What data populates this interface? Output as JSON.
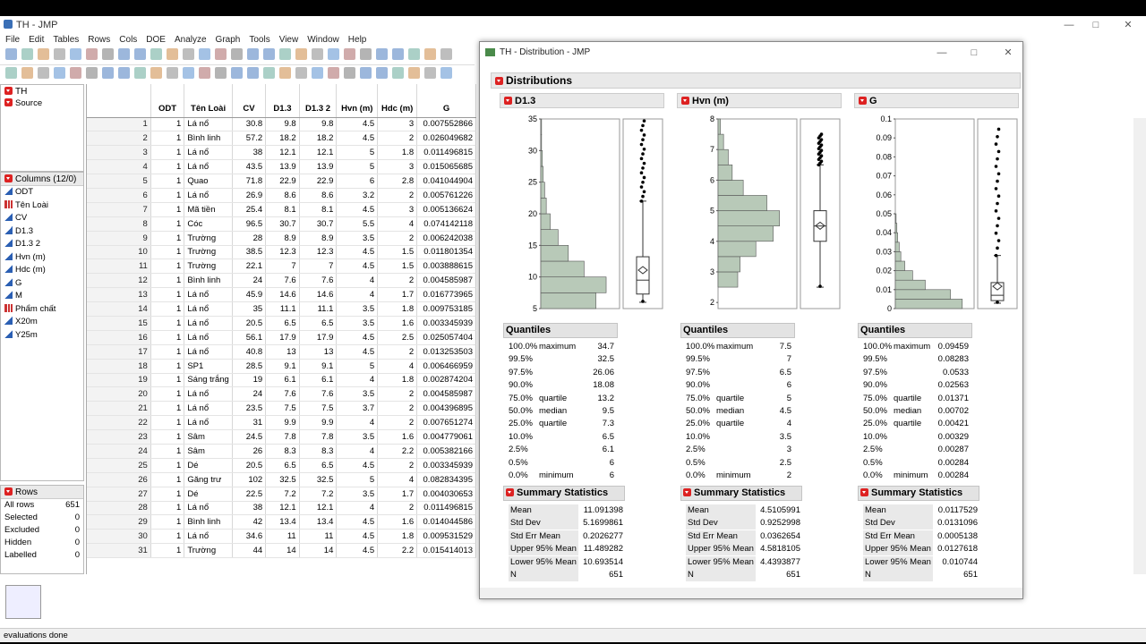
{
  "main": {
    "title": "TH - JMP",
    "menu": [
      "File",
      "Edit",
      "Tables",
      "Rows",
      "Cols",
      "DOE",
      "Analyze",
      "Graph",
      "Tools",
      "View",
      "Window",
      "Help"
    ],
    "status": "evaluations done"
  },
  "left": {
    "table_name": "TH",
    "source": "Source",
    "columns_header": "Columns (12/0)",
    "columns": [
      {
        "name": "ODT",
        "type": "continuous"
      },
      {
        "name": "Tên Loài",
        "type": "nominal"
      },
      {
        "name": "CV",
        "type": "continuous"
      },
      {
        "name": "D1.3",
        "type": "continuous"
      },
      {
        "name": "D1.3 2",
        "type": "continuous"
      },
      {
        "name": "Hvn (m)",
        "type": "continuous"
      },
      {
        "name": "Hdc (m)",
        "type": "continuous"
      },
      {
        "name": "G",
        "type": "continuous"
      },
      {
        "name": "M",
        "type": "continuous"
      },
      {
        "name": "Phẩm chất",
        "type": "nominal"
      },
      {
        "name": "X20m",
        "type": "continuous"
      },
      {
        "name": "Y25m",
        "type": "continuous"
      }
    ],
    "rows_header": "Rows",
    "rows_stats": [
      {
        "label": "All rows",
        "value": "651"
      },
      {
        "label": "Selected",
        "value": "0"
      },
      {
        "label": "Excluded",
        "value": "0"
      },
      {
        "label": "Hidden",
        "value": "0"
      },
      {
        "label": "Labelled",
        "value": "0"
      }
    ]
  },
  "table": {
    "headers": [
      "ODT",
      "Tên Loài",
      "CV",
      "D1.3",
      "D1.3 2",
      "Hvn (m)",
      "Hdc (m)",
      "G"
    ],
    "rows": [
      [
        "1",
        "1",
        "Lá nổ",
        "30.8",
        "9.8",
        "9.8",
        "4.5",
        "3",
        "0.007552866"
      ],
      [
        "2",
        "1",
        "Bình linh",
        "57.2",
        "18.2",
        "18.2",
        "4.5",
        "2",
        "0.026049682"
      ],
      [
        "3",
        "1",
        "Lá nổ",
        "38",
        "12.1",
        "12.1",
        "5",
        "1.8",
        "0.011496815"
      ],
      [
        "4",
        "1",
        "Lá nổ",
        "43.5",
        "13.9",
        "13.9",
        "5",
        "3",
        "0.015065685"
      ],
      [
        "5",
        "1",
        "Quao",
        "71.8",
        "22.9",
        "22.9",
        "6",
        "2.8",
        "0.041044904"
      ],
      [
        "6",
        "1",
        "Lá nổ",
        "26.9",
        "8.6",
        "8.6",
        "3.2",
        "2",
        "0.005761226"
      ],
      [
        "7",
        "1",
        "Mã tiền",
        "25.4",
        "8.1",
        "8.1",
        "4.5",
        "3",
        "0.005136624"
      ],
      [
        "8",
        "1",
        "Cóc",
        "96.5",
        "30.7",
        "30.7",
        "5.5",
        "4",
        "0.074142118"
      ],
      [
        "9",
        "1",
        "Trường",
        "28",
        "8.9",
        "8.9",
        "3.5",
        "2",
        "0.006242038"
      ],
      [
        "10",
        "1",
        "Trường",
        "38.5",
        "12.3",
        "12.3",
        "4.5",
        "1.5",
        "0.011801354"
      ],
      [
        "11",
        "1",
        "Trường",
        "22.1",
        "7",
        "7",
        "4.5",
        "1.5",
        "0.003888615"
      ],
      [
        "12",
        "1",
        "Bình linh",
        "24",
        "7.6",
        "7.6",
        "4",
        "2",
        "0.004585987"
      ],
      [
        "13",
        "1",
        "Lá nổ",
        "45.9",
        "14.6",
        "14.6",
        "4",
        "1.7",
        "0.016773965"
      ],
      [
        "14",
        "1",
        "Lá nổ",
        "35",
        "11.1",
        "11.1",
        "3.5",
        "1.8",
        "0.009753185"
      ],
      [
        "15",
        "1",
        "Lá nổ",
        "20.5",
        "6.5",
        "6.5",
        "3.5",
        "1.6",
        "0.003345939"
      ],
      [
        "16",
        "1",
        "Lá nổ",
        "56.1",
        "17.9",
        "17.9",
        "4.5",
        "2.5",
        "0.025057404"
      ],
      [
        "17",
        "1",
        "Lá nổ",
        "40.8",
        "13",
        "13",
        "4.5",
        "2",
        "0.013253503"
      ],
      [
        "18",
        "1",
        "SP1",
        "28.5",
        "9.1",
        "9.1",
        "5",
        "4",
        "0.006466959"
      ],
      [
        "19",
        "1",
        "Sáng trắng",
        "19",
        "6.1",
        "6.1",
        "4",
        "1.8",
        "0.002874204"
      ],
      [
        "20",
        "1",
        "Lá nổ",
        "24",
        "7.6",
        "7.6",
        "3.5",
        "2",
        "0.004585987"
      ],
      [
        "21",
        "1",
        "Lá nổ",
        "23.5",
        "7.5",
        "7.5",
        "3.7",
        "2",
        "0.004396895"
      ],
      [
        "22",
        "1",
        "Lá nổ",
        "31",
        "9.9",
        "9.9",
        "4",
        "2",
        "0.007651274"
      ],
      [
        "23",
        "1",
        "Sâm",
        "24.5",
        "7.8",
        "7.8",
        "3.5",
        "1.6",
        "0.004779061"
      ],
      [
        "24",
        "1",
        "Sâm",
        "26",
        "8.3",
        "8.3",
        "4",
        "2.2",
        "0.005382166"
      ],
      [
        "25",
        "1",
        "Dé",
        "20.5",
        "6.5",
        "6.5",
        "4.5",
        "2",
        "0.003345939"
      ],
      [
        "26",
        "1",
        "Găng trư",
        "102",
        "32.5",
        "32.5",
        "5",
        "4",
        "0.082834395"
      ],
      [
        "27",
        "1",
        "Dé",
        "22.5",
        "7.2",
        "7.2",
        "3.5",
        "1.7",
        "0.004030653"
      ],
      [
        "28",
        "1",
        "Lá nổ",
        "38",
        "12.1",
        "12.1",
        "4",
        "2",
        "0.011496815"
      ],
      [
        "29",
        "1",
        "Bình linh",
        "42",
        "13.4",
        "13.4",
        "4.5",
        "1.6",
        "0.014044586"
      ],
      [
        "30",
        "1",
        "Lá nổ",
        "34.6",
        "11",
        "11",
        "4.5",
        "1.8",
        "0.009531529"
      ],
      [
        "31",
        "1",
        "Trường",
        "44",
        "14",
        "14",
        "4.5",
        "2.2",
        "0.015414013"
      ]
    ]
  },
  "dist": {
    "title": "TH - Distribution - JMP",
    "heading": "Distributions",
    "quantiles_label": "Quantiles",
    "summary_label": "Summary Statistics",
    "vars": [
      {
        "name": "D1.3",
        "quantiles": [
          [
            "100.0%",
            "maximum",
            "34.7"
          ],
          [
            "99.5%",
            "",
            "32.5"
          ],
          [
            "97.5%",
            "",
            "26.06"
          ],
          [
            "90.0%",
            "",
            "18.08"
          ],
          [
            "75.0%",
            "quartile",
            "13.2"
          ],
          [
            "50.0%",
            "median",
            "9.5"
          ],
          [
            "25.0%",
            "quartile",
            "7.3"
          ],
          [
            "10.0%",
            "",
            "6.5"
          ],
          [
            "2.5%",
            "",
            "6.1"
          ],
          [
            "0.5%",
            "",
            "6"
          ],
          [
            "0.0%",
            "minimum",
            "6"
          ]
        ],
        "summary": [
          [
            "Mean",
            "11.091398"
          ],
          [
            "Std Dev",
            "5.1699861"
          ],
          [
            "Std Err Mean",
            "0.2026277"
          ],
          [
            "Upper 95% Mean",
            "11.489282"
          ],
          [
            "Lower 95% Mean",
            "10.693514"
          ],
          [
            "N",
            "651"
          ]
        ]
      },
      {
        "name": "Hvn (m)",
        "quantiles": [
          [
            "100.0%",
            "maximum",
            "7.5"
          ],
          [
            "99.5%",
            "",
            "7"
          ],
          [
            "97.5%",
            "",
            "6.5"
          ],
          [
            "90.0%",
            "",
            "6"
          ],
          [
            "75.0%",
            "quartile",
            "5"
          ],
          [
            "50.0%",
            "median",
            "4.5"
          ],
          [
            "25.0%",
            "quartile",
            "4"
          ],
          [
            "10.0%",
            "",
            "3.5"
          ],
          [
            "2.5%",
            "",
            "3"
          ],
          [
            "0.5%",
            "",
            "2.5"
          ],
          [
            "0.0%",
            "minimum",
            "2"
          ]
        ],
        "summary": [
          [
            "Mean",
            "4.5105991"
          ],
          [
            "Std Dev",
            "0.9252998"
          ],
          [
            "Std Err Mean",
            "0.0362654"
          ],
          [
            "Upper 95% Mean",
            "4.5818105"
          ],
          [
            "Lower 95% Mean",
            "4.4393877"
          ],
          [
            "N",
            "651"
          ]
        ]
      },
      {
        "name": "G",
        "quantiles": [
          [
            "100.0%",
            "maximum",
            "0.09459"
          ],
          [
            "99.5%",
            "",
            "0.08283"
          ],
          [
            "97.5%",
            "",
            "0.0533"
          ],
          [
            "90.0%",
            "",
            "0.02563"
          ],
          [
            "75.0%",
            "quartile",
            "0.01371"
          ],
          [
            "50.0%",
            "median",
            "0.00702"
          ],
          [
            "25.0%",
            "quartile",
            "0.00421"
          ],
          [
            "10.0%",
            "",
            "0.00329"
          ],
          [
            "2.5%",
            "",
            "0.00287"
          ],
          [
            "0.5%",
            "",
            "0.00284"
          ],
          [
            "0.0%",
            "minimum",
            "0.00284"
          ]
        ],
        "summary": [
          [
            "Mean",
            "0.0117529"
          ],
          [
            "Std Dev",
            "0.0131096"
          ],
          [
            "Std Err Mean",
            "0.0005138"
          ],
          [
            "Upper 95% Mean",
            "0.0127618"
          ],
          [
            "Lower 95% Mean",
            "0.010744"
          ],
          [
            "N",
            "651"
          ]
        ]
      }
    ]
  },
  "chart_data": [
    {
      "type": "bar",
      "title": "D1.3",
      "orientation": "horizontal histogram",
      "yticks": [
        5,
        10,
        15,
        20,
        25,
        30,
        35
      ],
      "ylim": [
        5,
        35
      ],
      "bin_width": 2.5,
      "bins": [
        [
          5,
          7.5,
          0.7
        ],
        [
          7.5,
          10,
          0.83
        ],
        [
          10,
          12.5,
          0.55
        ],
        [
          12.5,
          15,
          0.35
        ],
        [
          15,
          17.5,
          0.22
        ],
        [
          17.5,
          20,
          0.12
        ],
        [
          20,
          22.5,
          0.07
        ],
        [
          22.5,
          25,
          0.05
        ],
        [
          25,
          27.5,
          0.03
        ],
        [
          27.5,
          30,
          0.02
        ],
        [
          30,
          32.5,
          0.01
        ],
        [
          32.5,
          35,
          0.01
        ]
      ],
      "box": {
        "min": 6,
        "q1": 7.3,
        "median": 9.5,
        "q3": 13.2,
        "whisker_high": 22,
        "mean": 11.09,
        "max": 34.7
      },
      "color": "#b8c9b8"
    },
    {
      "type": "bar",
      "title": "Hvn (m)",
      "orientation": "horizontal histogram",
      "yticks": [
        2,
        3,
        4,
        5,
        6,
        7,
        8
      ],
      "ylim": [
        1.8,
        8
      ],
      "bin_width": 0.5,
      "bins": [
        [
          2.5,
          3,
          0.25
        ],
        [
          3,
          3.5,
          0.28
        ],
        [
          3.5,
          4,
          0.48
        ],
        [
          4,
          4.5,
          0.7
        ],
        [
          4.5,
          5,
          0.78
        ],
        [
          5,
          5.5,
          0.62
        ],
        [
          5.5,
          6,
          0.32
        ],
        [
          6,
          6.5,
          0.18
        ],
        [
          6.5,
          7,
          0.13
        ],
        [
          7,
          7.5,
          0.07
        ],
        [
          7.5,
          8,
          0.03
        ]
      ],
      "box": {
        "min": 2.5,
        "q1": 4,
        "median": 4.5,
        "q3": 5,
        "whisker_high": 6.5,
        "mean": 4.51,
        "max": 7.5
      },
      "color": "#b8c9b8"
    },
    {
      "type": "bar",
      "title": "G",
      "orientation": "horizontal histogram",
      "yticks": [
        0,
        0.01,
        0.02,
        0.03,
        0.04,
        0.05,
        0.06,
        0.07,
        0.08,
        0.09,
        0.1
      ],
      "ylim": [
        0,
        0.1
      ],
      "bin_width": 0.005,
      "bins": [
        [
          0,
          0.005,
          0.85
        ],
        [
          0.005,
          0.01,
          0.7
        ],
        [
          0.01,
          0.015,
          0.38
        ],
        [
          0.015,
          0.02,
          0.22
        ],
        [
          0.02,
          0.025,
          0.12
        ],
        [
          0.025,
          0.03,
          0.07
        ],
        [
          0.03,
          0.035,
          0.05
        ],
        [
          0.035,
          0.04,
          0.03
        ],
        [
          0.04,
          0.045,
          0.02
        ],
        [
          0.045,
          0.05,
          0.01
        ]
      ],
      "box": {
        "min": 0.00284,
        "q1": 0.00421,
        "median": 0.00702,
        "q3": 0.01371,
        "whisker_high": 0.028,
        "mean": 0.01175,
        "max": 0.09459
      },
      "color": "#b8c9b8"
    }
  ]
}
